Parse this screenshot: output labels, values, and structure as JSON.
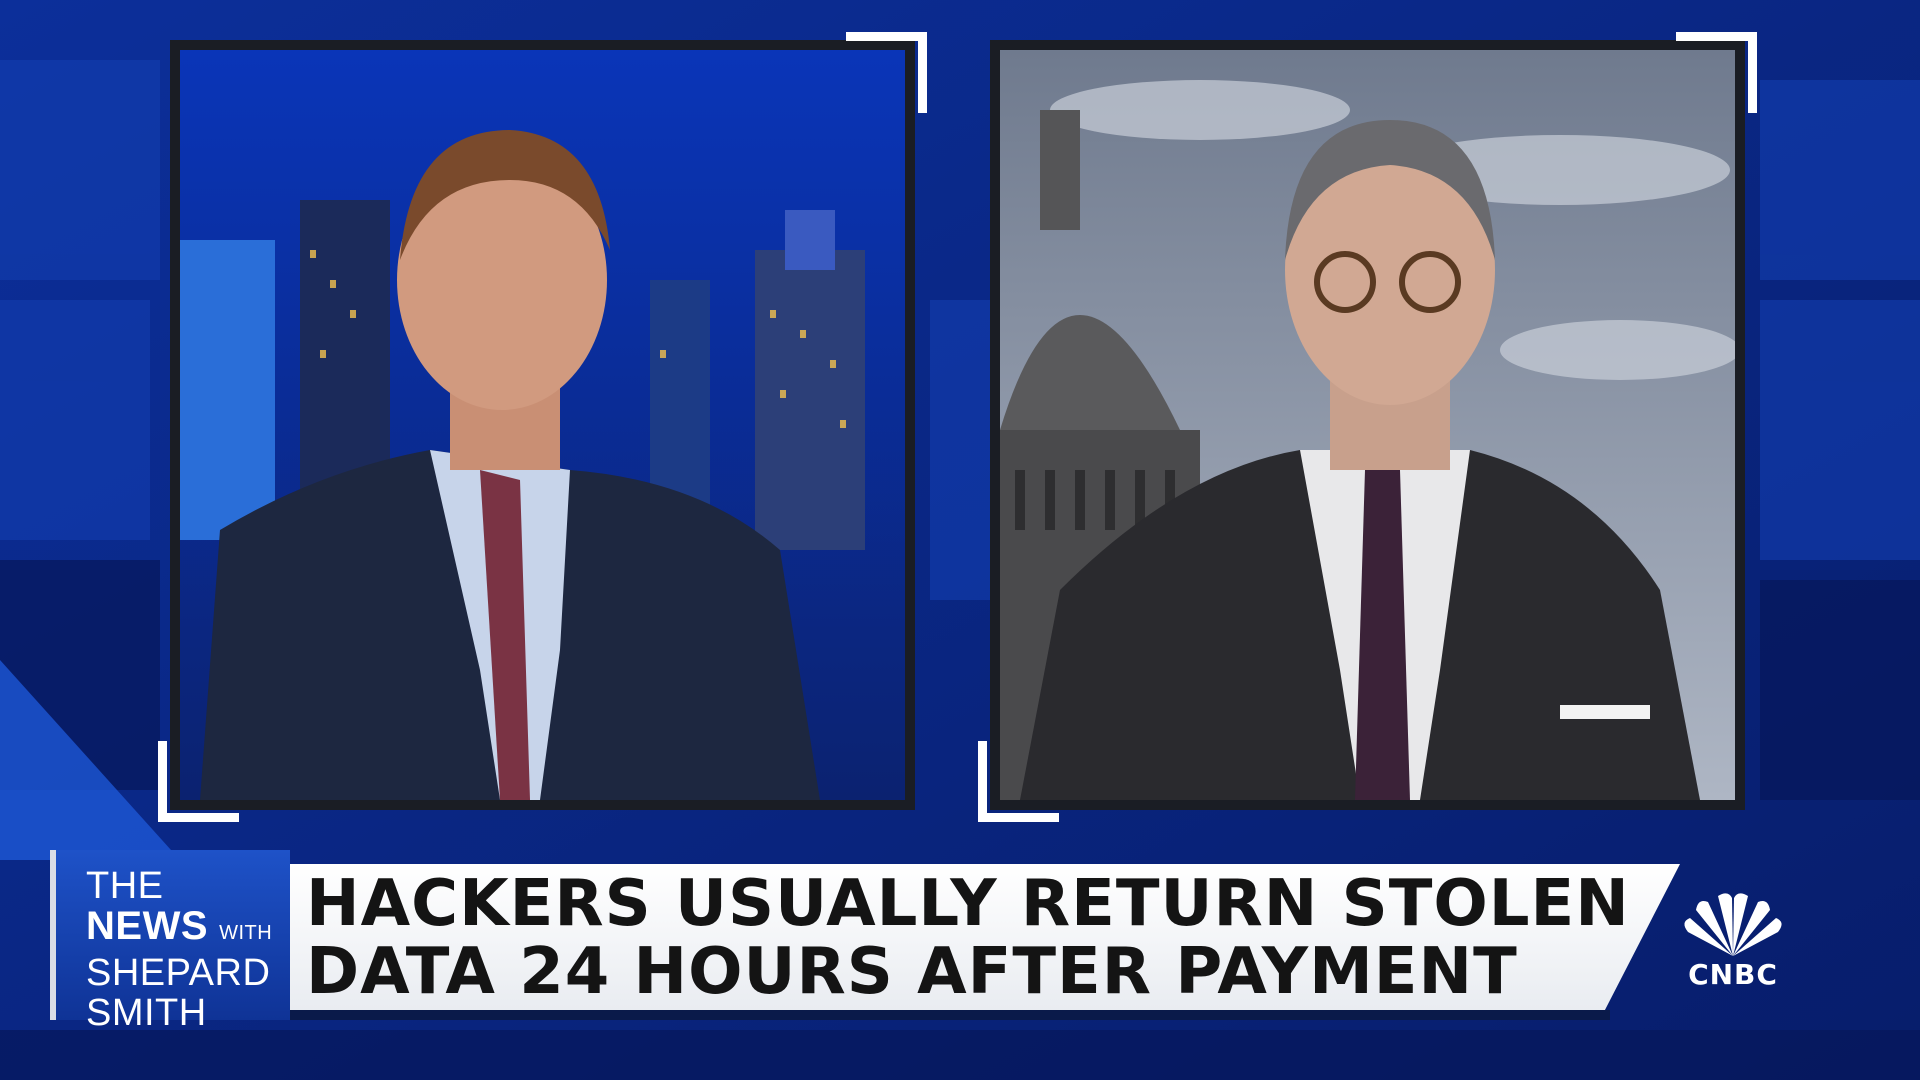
{
  "show": {
    "line1": "THE",
    "line2_news": "NEWS",
    "line2_with": "WITH",
    "line3": "SHEPARD",
    "line4": "SMITH"
  },
  "headline": {
    "line1": "HACKERS USUALLY RETURN STOLEN",
    "line2": "DATA 24 HOURS AFTER PAYMENT"
  },
  "network": {
    "name": "CNBC",
    "peacock_colors": [
      "#ffffff"
    ]
  },
  "colors": {
    "background_blue": "#0b2a8c",
    "accent_blue": "#1e52c8",
    "headline_text": "#141414"
  }
}
